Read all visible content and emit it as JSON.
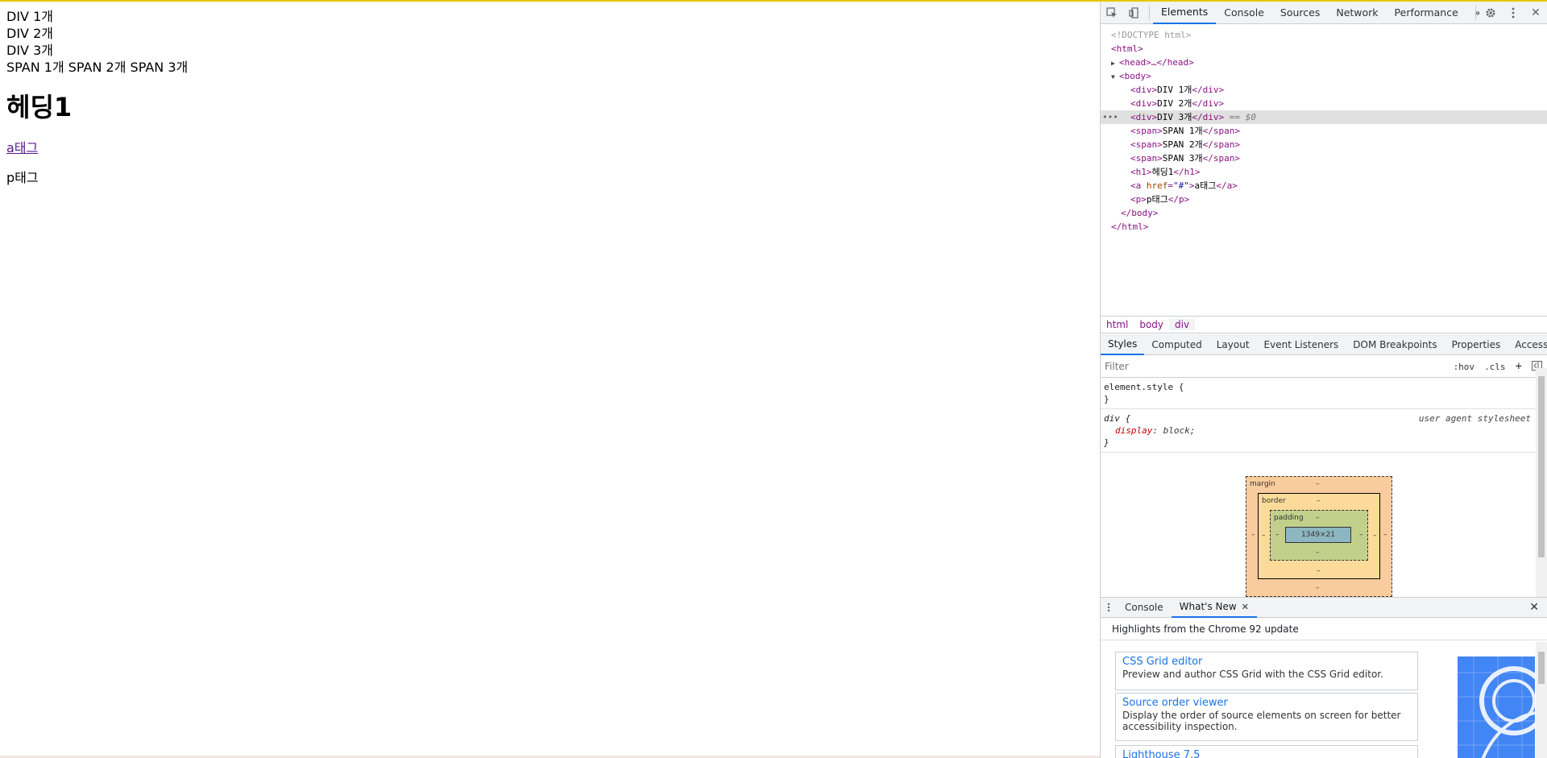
{
  "page": {
    "div1": "DIV 1개",
    "div2": "DIV 2개",
    "div3": "DIV 3개",
    "spans": "SPAN 1개 SPAN 2개 SPAN 3개",
    "heading": "헤딩1",
    "link": "a태그",
    "paragraph": "p태그"
  },
  "devtools": {
    "tabs": [
      "Elements",
      "Console",
      "Sources",
      "Network",
      "Performance"
    ],
    "more_tabs": "»",
    "dom": {
      "doctype": "<!DOCTYPE html>",
      "html_open": "<html>",
      "head": "<head>…</head>",
      "body_open": "<body>",
      "div1_text": "DIV 1개",
      "div2_text": "DIV 2개",
      "div3_text": "DIV 3개",
      "selected_marker": "== $0",
      "span1_text": "SPAN 1개",
      "span2_text": "SPAN 2개",
      "span3_text": "SPAN 3개",
      "h1_text": "헤딩1",
      "a_href": "\"#\"",
      "a_text": "a태그",
      "p_text": "p태그",
      "body_close": "</body>",
      "html_close": "</html>"
    },
    "breadcrumbs": [
      "html",
      "body",
      "div"
    ],
    "sub_tabs": [
      "Styles",
      "Computed",
      "Layout",
      "Event Listeners",
      "DOM Breakpoints",
      "Properties",
      "Accessibility"
    ],
    "filter": {
      "placeholder": "Filter",
      "hov": ":hov",
      "cls": ".cls",
      "plus": "+"
    },
    "styles": {
      "element_style": "element.style {",
      "close_brace": "}",
      "div_selector": "div {",
      "div_origin": "user agent stylesheet",
      "div_prop": "display",
      "div_value": "block;"
    },
    "box_model": {
      "margin": "margin",
      "border": "border",
      "padding": "padding",
      "dash": "–",
      "content_size": "1349×21"
    },
    "drawer": {
      "tabs": [
        "Console",
        "What's New"
      ],
      "headline": "Highlights from the Chrome 92 update",
      "cards": [
        {
          "title": "CSS Grid editor",
          "desc": "Preview and author CSS Grid with the CSS Grid editor."
        },
        {
          "title": "Source order viewer",
          "desc": "Display the order of source elements on screen for better accessibility inspection."
        },
        {
          "title": "Lighthouse 7.5",
          "desc": ""
        }
      ]
    }
  }
}
